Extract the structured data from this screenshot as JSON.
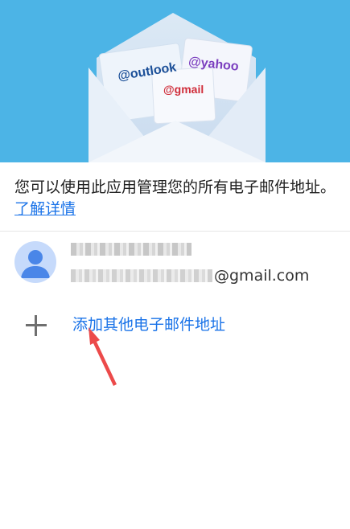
{
  "header": {
    "hero_tags": [
      "@outlook",
      "@yahoo",
      "@gmail"
    ]
  },
  "intro": {
    "text": "您可以使用此应用管理您的所有电子邮件地址。",
    "link_label": "了解详情"
  },
  "account": {
    "email_domain": "@gmail.com"
  },
  "add_account": {
    "label": "添加其他电子邮件地址"
  },
  "colors": {
    "accent": "#1a73e8",
    "hero_bg": "#4cb4e6",
    "annotation_arrow": "#ec4a4a"
  }
}
